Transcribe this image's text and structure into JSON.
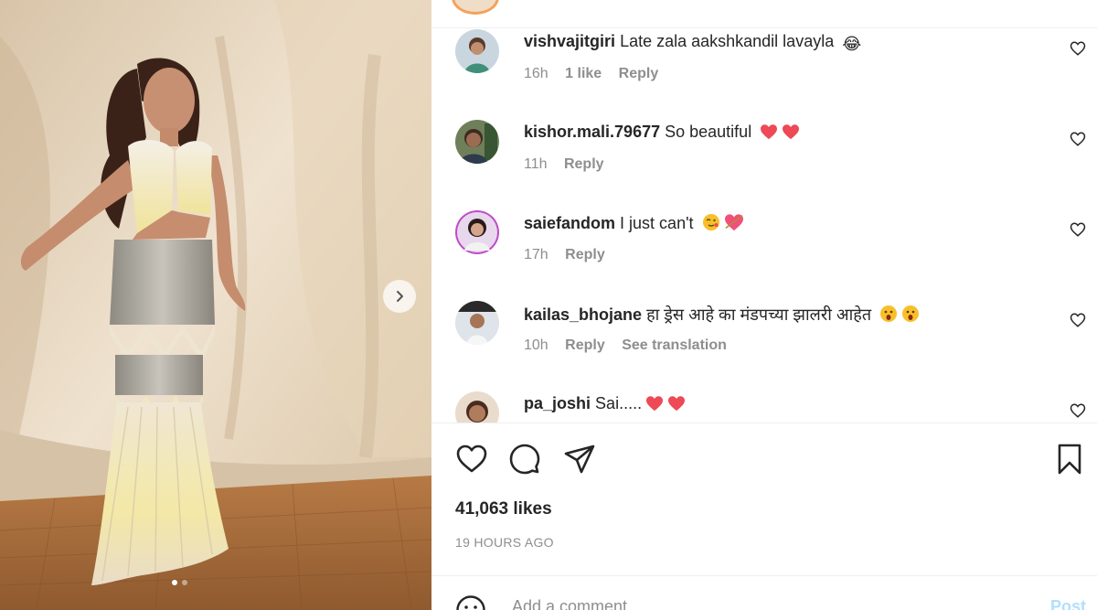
{
  "post": {
    "next_icon": "chevron-right-icon",
    "carousel": {
      "count": 2,
      "active": 0
    }
  },
  "comments": [
    {
      "username": "vishvajitgiri",
      "text": "Late zala aakshkandil lavayla",
      "emojis": [
        "😂"
      ],
      "time": "16h",
      "likes": "1 like",
      "reply": "Reply",
      "translate": ""
    },
    {
      "username": "kishor.mali.79677",
      "text": "So beautiful",
      "emojis": [
        "❤",
        "❤"
      ],
      "time": "11h",
      "likes": "",
      "reply": "Reply",
      "translate": ""
    },
    {
      "username": "saiefandom",
      "text": "I just can't",
      "emojis": [
        "😘",
        "💘"
      ],
      "time": "17h",
      "likes": "",
      "reply": "Reply",
      "translate": ""
    },
    {
      "username": "kailas_bhojane",
      "text": "हा ड्रेस आहे का मंडपच्या झालरी आहेत",
      "emojis": [
        "😱",
        "😱"
      ],
      "time": "10h",
      "likes": "",
      "reply": "Reply",
      "translate": "See translation"
    },
    {
      "username": "pa_joshi",
      "text": "Sai.....",
      "emojis": [
        "❤",
        "❤"
      ],
      "time": "",
      "likes": "",
      "reply": "",
      "translate": ""
    }
  ],
  "actions": {
    "like_icon": "heart-icon",
    "comment_icon": "comment-icon",
    "share_icon": "send-icon",
    "save_icon": "bookmark-icon"
  },
  "stats": {
    "likes": "41,063 likes",
    "posted": "19 HOURS AGO"
  },
  "add_comment": {
    "placeholder": "Add a comment...",
    "post_label": "Post",
    "emoji_icon": "smiley-icon"
  },
  "colors": {
    "heart_red": "#ed4956",
    "text": "#262626",
    "muted": "#8e8e8e",
    "post_disabled": "#b2dffc"
  }
}
